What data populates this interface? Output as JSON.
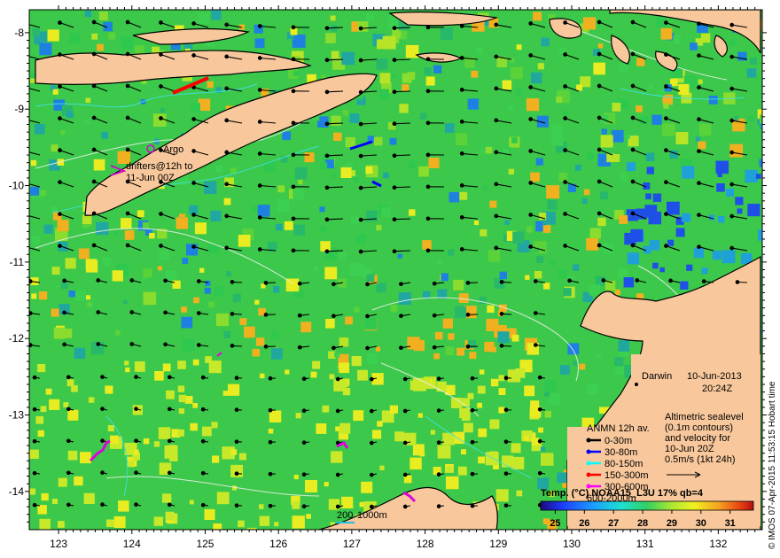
{
  "map": {
    "lon_ticks": [
      "123",
      "124",
      "125",
      "126",
      "127",
      "128",
      "129",
      "130",
      "131",
      "132"
    ],
    "lat_ticks": [
      "-8",
      "-9",
      "-10",
      "-11",
      "-12",
      "-13",
      "-14"
    ],
    "lon_range": [
      122.6,
      132.6
    ],
    "lat_range": [
      -7.7,
      -14.5
    ]
  },
  "labels": {
    "argo": "Argo",
    "drifters_line1": "drifters@12h to",
    "drifters_line2": "11-Jun 00Z",
    "darwin": "Darwin",
    "date": "10-Jun-2013",
    "time": "20:24Z",
    "scale_bar": "200",
    "contour_1000m": "1000m"
  },
  "legend": {
    "anmn_title": "ANMN 12h av.",
    "depths": [
      {
        "label": "0-30m",
        "color": "#000000"
      },
      {
        "label": "30-80m",
        "color": "#0000ff"
      },
      {
        "label": "80-150m",
        "color": "#00ffff"
      },
      {
        "label": "150-300m",
        "color": "#ff0000"
      },
      {
        "label": "300-600m",
        "color": "#ff00ff"
      }
    ],
    "altimetry_lines": [
      "Altimetric sealevel",
      "(0.1m contours)",
      "and velocity for",
      "10-Jun 20Z",
      "0.5m/s (1kt 24h)"
    ],
    "depth_partial": "600-2000m"
  },
  "colorbar": {
    "title": "Temp. (°C) NOAA15_L3U 17% qb=4",
    "ticks": [
      "25",
      "26",
      "27",
      "28",
      "29",
      "30",
      "31"
    ],
    "min": 24.5,
    "max": 31.8
  },
  "credit": "© IMOS 07-Apr-2015 11:53:15 Hobart time"
}
